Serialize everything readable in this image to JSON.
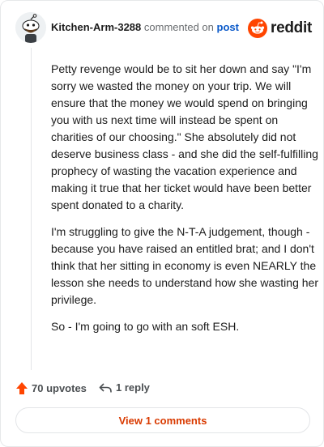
{
  "header": {
    "username": "Kitchen-Arm-3288",
    "commented_text": "commented on",
    "post_link": "post",
    "logo_text": "reddit"
  },
  "comment": {
    "paragraphs": [
      "Petty revenge would be to sit her down and say \"I'm sorry we wasted the money on your trip. We will ensure that the money we would spend on bringing you with us next time will instead be spent on charities of our choosing.\" She absolutely did not deserve business class - and she did the self-fulfilling prophecy of wasting the vacation experience and making it true that her ticket would have been better spent donated to a charity.",
      "I'm struggling to give the N-T-A judgement, though - because you have raised an entitled brat; and I don't think that her sitting in economy is even NEARLY the lesson she needs to understand how she wasting her privilege.",
      "So - I'm going to go with an soft ESH."
    ]
  },
  "actions": {
    "upvotes": "70 upvotes",
    "replies": "1 reply",
    "view_comments": "View 1 comments"
  },
  "colors": {
    "accent": "#d93a00",
    "upvote": "#ff4500",
    "link": "#0a59c9"
  },
  "icons": {
    "avatar": "snoo-avatar",
    "logo": "reddit-logo-icon",
    "upvote": "upvote-arrow-icon",
    "reply": "reply-arrow-icon"
  }
}
